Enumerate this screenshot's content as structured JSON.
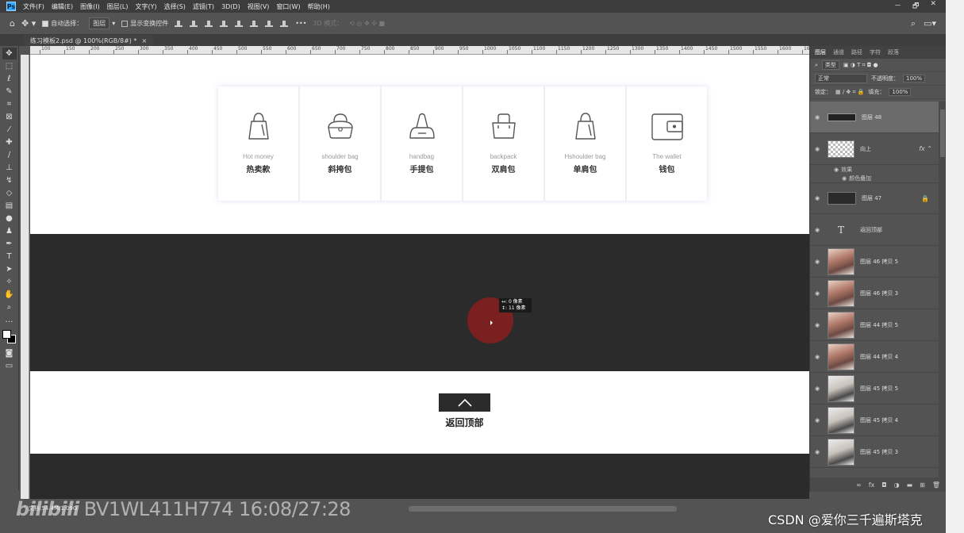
{
  "app": {
    "logo": "Ps",
    "menu": [
      "文件(F)",
      "编辑(E)",
      "图像(I)",
      "图层(L)",
      "文字(Y)",
      "选择(S)",
      "滤镜(T)",
      "3D(D)",
      "视图(V)",
      "窗口(W)",
      "帮助(H)"
    ],
    "window_controls": [
      "－",
      "🗗",
      "✕"
    ]
  },
  "options": {
    "auto_select": "自动选择：",
    "auto_select_target": "图层",
    "show_transform": "显示变换控件",
    "mode_3d": "3D 模式：",
    "more": "•••"
  },
  "document": {
    "tab_title": "练习模板2.psd @ 100%(RGB/8#) *",
    "close": "×"
  },
  "ruler": {
    "h_labels": [
      "100",
      "150",
      "200",
      "250",
      "300",
      "350",
      "400",
      "450",
      "500",
      "550",
      "600",
      "650",
      "700",
      "750",
      "800",
      "850",
      "900",
      "950",
      "1000",
      "1050",
      "1100",
      "1150",
      "1200",
      "1250",
      "1300",
      "1350",
      "1400",
      "1450",
      "1500",
      "1550",
      "1600",
      "1650"
    ]
  },
  "canvas": {
    "categories": [
      {
        "en": "Hot money",
        "cn": "热卖款",
        "icon": "handbag-icon"
      },
      {
        "en": "shoulder bag",
        "cn": "斜挎包",
        "icon": "shoulder-bag-icon"
      },
      {
        "en": "handbag",
        "cn": "手提包",
        "icon": "tote-icon"
      },
      {
        "en": "backpack",
        "cn": "双肩包",
        "icon": "backpack-icon"
      },
      {
        "en": "Hshoulder bag",
        "cn": "单肩包",
        "icon": "bucket-bag-icon"
      },
      {
        "en": "The wallet",
        "cn": "钱包",
        "icon": "wallet-icon"
      }
    ],
    "measure_tip": {
      "w": "↔: 0 像素",
      "h": "↕: 11 像素"
    },
    "back_to_top": "返回顶部"
  },
  "layers_panel": {
    "tabs": [
      "图层",
      "通道",
      "路径",
      "字符",
      "段落"
    ],
    "filter": "类型",
    "blend_mode": "正常",
    "opacity_label": "不透明度：",
    "opacity": "100%",
    "lock_label": "锁定：",
    "fill_label": "填充：",
    "fill": "100%",
    "layers": [
      {
        "name": "图层 48",
        "thumb": "wide",
        "selected": true
      },
      {
        "name": "向上",
        "thumb": "check",
        "fx": true,
        "effects_label": "效果",
        "effect": "颜色叠加"
      },
      {
        "name": "图层 47",
        "thumb": "dark",
        "locked": true
      },
      {
        "name": "返回顶部",
        "thumb": "text"
      },
      {
        "name": "图层 46 拷贝 5",
        "thumb": "photo"
      },
      {
        "name": "图层 46 拷贝 3",
        "thumb": "photo"
      },
      {
        "name": "图层 44 拷贝 5",
        "thumb": "photo"
      },
      {
        "name": "图层 44 拷贝 4",
        "thumb": "photo"
      },
      {
        "name": "图层 45 拷贝 5",
        "thumb": "photo2"
      },
      {
        "name": "图层 45 拷贝 4",
        "thumb": "photo2"
      },
      {
        "name": "图层 45 拷贝 3",
        "thumb": "photo2"
      }
    ],
    "footer_icons": [
      "link-icon",
      "fx-icon",
      "mask-icon",
      "adjustment-icon",
      "folder-icon",
      "new-layer-icon",
      "trash-icon"
    ]
  },
  "status": {
    "zoom_info": "文档:54.4M/1.09G"
  },
  "overlay": {
    "watermark_logo": "bilibili",
    "watermark_text": "BV1WL411H774 16:08/27:28",
    "csdn": "CSDN @爱你三千遍斯塔克"
  },
  "colors": {
    "ps_blue": "#31a8ff",
    "ui_gray": "#535353",
    "canvas_dark": "#2b2b2b",
    "cursor_red": "#962020"
  }
}
